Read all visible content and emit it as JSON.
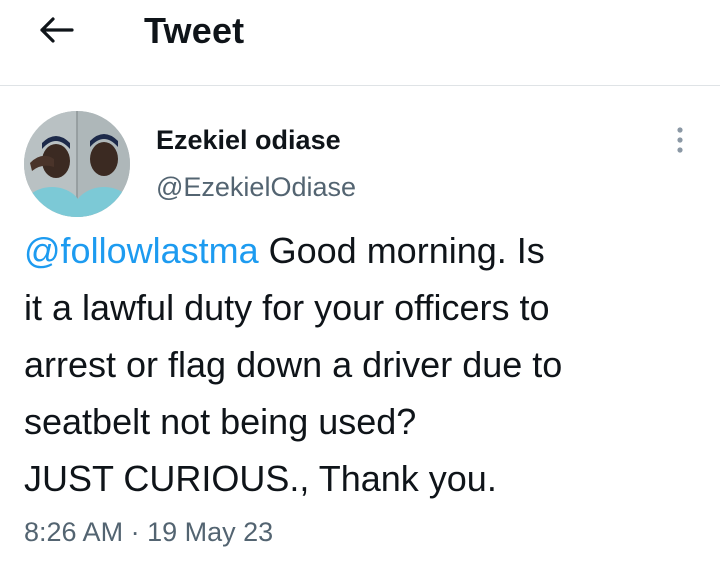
{
  "header": {
    "title": "Tweet",
    "back_icon": "arrow-left-icon"
  },
  "tweet": {
    "author": {
      "name": "Ezekiel odiase",
      "handle": "@EzekielOdiase",
      "avatar_icon": "profile-photo"
    },
    "more_icon": "vertical-ellipsis-icon",
    "mention": "@followlastma",
    "text_line1": " Good morning. Is",
    "text_line2": "it a lawful duty for your officers to",
    "text_line3": "arrest or flag down a driver due to",
    "text_line4": "seatbelt not being used?",
    "text_line5": "JUST CURIOUS., Thank you.",
    "time": "8:26 AM",
    "separator": " · ",
    "date": "19 May 23"
  },
  "colors": {
    "link": "#1d9bf0",
    "text": "#0f1419",
    "secondary": "#536471",
    "divider": "#dfe3e6"
  }
}
